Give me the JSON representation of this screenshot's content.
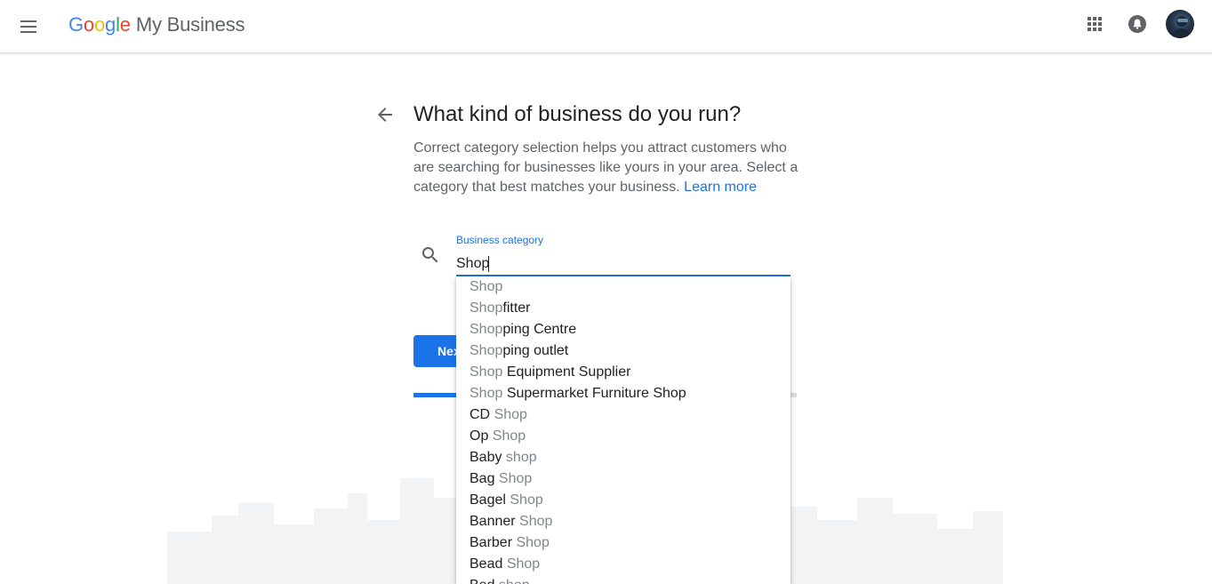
{
  "header": {
    "logo_letters": [
      "G",
      "o",
      "o",
      "g",
      "l",
      "e"
    ],
    "product": "My Business"
  },
  "page": {
    "title": "What kind of business do you run?",
    "description": "Correct category selection helps you attract customers who are searching for businesses like yours in your area. Select a category that best matches your business.",
    "learn_more": "Learn more"
  },
  "field": {
    "label": "Business category",
    "value": "Shop"
  },
  "next_button": {
    "label": "Next"
  },
  "progress": {
    "fraction": 0.33
  },
  "dropdown": {
    "options": [
      {
        "parts": [
          {
            "text": "Shop",
            "match": true
          }
        ]
      },
      {
        "parts": [
          {
            "text": "Shop",
            "match": true
          },
          {
            "text": "fitter",
            "match": false
          }
        ]
      },
      {
        "parts": [
          {
            "text": "Shop",
            "match": true
          },
          {
            "text": "ping Centre",
            "match": false
          }
        ]
      },
      {
        "parts": [
          {
            "text": "Shop",
            "match": true
          },
          {
            "text": "ping outlet",
            "match": false
          }
        ]
      },
      {
        "parts": [
          {
            "text": "Shop",
            "match": true
          },
          {
            "text": " Equipment Supplier",
            "match": false
          }
        ]
      },
      {
        "parts": [
          {
            "text": "Shop",
            "match": true
          },
          {
            "text": " Supermarket Furniture Shop",
            "match": false
          }
        ]
      },
      {
        "parts": [
          {
            "text": "CD ",
            "match": false
          },
          {
            "text": "Shop",
            "match": true
          }
        ]
      },
      {
        "parts": [
          {
            "text": "Op ",
            "match": false
          },
          {
            "text": "Shop",
            "match": true
          }
        ]
      },
      {
        "parts": [
          {
            "text": "Baby ",
            "match": false
          },
          {
            "text": "shop",
            "match": true
          }
        ]
      },
      {
        "parts": [
          {
            "text": "Bag ",
            "match": false
          },
          {
            "text": "Shop",
            "match": true
          }
        ]
      },
      {
        "parts": [
          {
            "text": "Bagel ",
            "match": false
          },
          {
            "text": "Shop",
            "match": true
          }
        ]
      },
      {
        "parts": [
          {
            "text": "Banner ",
            "match": false
          },
          {
            "text": "Shop",
            "match": true
          }
        ]
      },
      {
        "parts": [
          {
            "text": "Barber ",
            "match": false
          },
          {
            "text": "Shop",
            "match": true
          }
        ]
      },
      {
        "parts": [
          {
            "text": "Bead ",
            "match": false
          },
          {
            "text": "Shop",
            "match": true
          }
        ]
      },
      {
        "parts": [
          {
            "text": "Bed ",
            "match": false
          },
          {
            "text": "shop",
            "match": true
          }
        ]
      }
    ]
  },
  "icons": {
    "menu": "hamburger-menu-icon",
    "apps": "apps-grid-icon",
    "notifications": "bell-icon",
    "back": "arrow-back-icon",
    "search": "search-icon"
  },
  "colors": {
    "accent": "#1a73e8",
    "match_text": "#80868b",
    "text": "#202124",
    "muted": "#5f6368"
  }
}
